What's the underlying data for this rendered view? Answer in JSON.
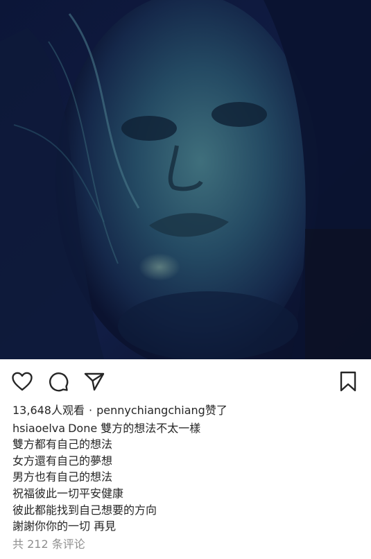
{
  "post": {
    "views_count": "13,648",
    "views_label": "人观看",
    "separator": "·",
    "liked_by_user": "pennychiangchiang",
    "liked_suffix": "赞了",
    "caption_user": "hsiaoelva",
    "caption_lines": [
      "Done 雙方的想法不太一樣",
      "雙方都有自己的想法",
      "女方還有自己的夢想",
      "男方也有自己的想法",
      "祝福彼此一切平安健康",
      "彼此都能找到自己想要的方向",
      "謝謝你你的一切  再見"
    ],
    "comments_link": "共 212 条评论"
  },
  "actions": {
    "like_icon": "heart-icon",
    "comment_icon": "comment-icon",
    "share_icon": "send-icon",
    "save_icon": "bookmark-icon"
  },
  "colors": {
    "text": "#262626",
    "muted": "#8e8e8e",
    "media_tint": "#1f3b5c"
  }
}
